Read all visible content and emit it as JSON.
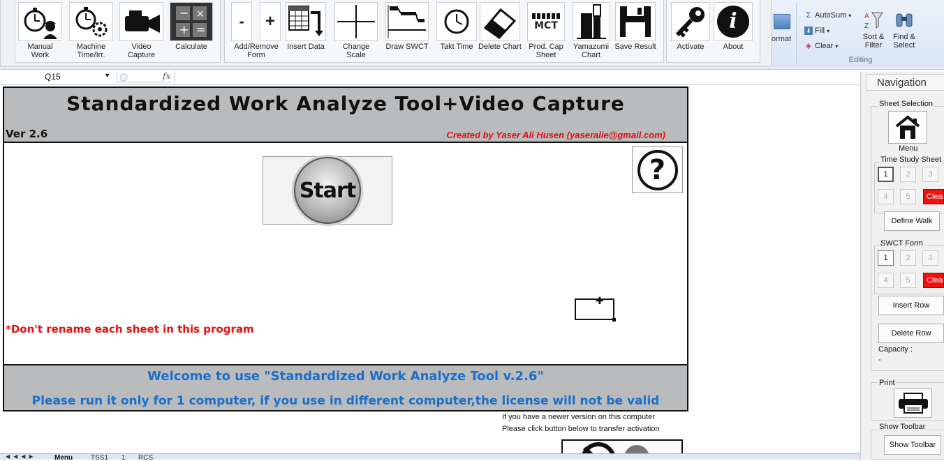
{
  "toolbar": {
    "groups": [
      {
        "buttons": [
          {
            "label": "Manual Work",
            "icon": "stopwatch-worker-icon"
          },
          {
            "label": "Machine Time/Irr.",
            "icon": "stopwatch-gear-icon"
          },
          {
            "label": "Video Capture",
            "icon": "video-camera-icon"
          },
          {
            "label": "Calculate",
            "icon": "calculator-icon"
          }
        ]
      },
      {
        "buttons": [
          {
            "label": "-",
            "icon": "minus-icon"
          },
          {
            "label": "+",
            "icon": "plus-icon"
          },
          {
            "label": "Add/Remove Form",
            "icon": ""
          },
          {
            "label": "Insert Data",
            "icon": "insert-data-icon"
          },
          {
            "label": "Change Scale",
            "icon": "change-scale-icon"
          },
          {
            "label": "Draw SWCT",
            "icon": "draw-swct-icon"
          },
          {
            "label": "Takt Time",
            "icon": "clock-icon"
          },
          {
            "label": "Delete Chart",
            "icon": "eraser-icon"
          },
          {
            "label": "Prod. Cap Sheet",
            "icon": "mct-icon",
            "icon_text": "MCT"
          },
          {
            "label": "Yamazumi Chart",
            "icon": "yamazumi-chart-icon"
          },
          {
            "label": "Save Result",
            "icon": "floppy-disk-icon"
          }
        ]
      },
      {
        "buttons": [
          {
            "label": "Activate",
            "icon": "key-icon"
          },
          {
            "label": "About",
            "icon": "info-icon",
            "icon_text": "i"
          }
        ]
      }
    ]
  },
  "excel_ribbon": {
    "format_label": "ormat",
    "autosum": "AutoSum",
    "fill": "Fill",
    "clear": "Clear",
    "sort_filter": "Sort & Filter",
    "find_select": "Find & Select",
    "group_label": "Editing"
  },
  "formula_bar": {
    "name_box": "Q15",
    "fx": "fx",
    "formula": ""
  },
  "sheet": {
    "title": "Standardized Work Analyze Tool+Video Capture",
    "version": "Ver 2.6",
    "creator": "Created by Yaser Ali Husen (yaseralie@gmail.com)",
    "start_label": "Start",
    "help_symbol": "?",
    "warning": "*Don't rename each sheet in this program",
    "welcome": "Welcome to use \"Standardized Work Analyze Tool v.2.6\"",
    "license_note": "Please run it only for 1 computer, if you use in different computer,the license will not be valid",
    "newer_version_note": "If you have a newer version on this computer",
    "transfer_note": "Please click button below to transfer activation"
  },
  "tabs": {
    "nav_arrows": "◀◀◀▶",
    "items": [
      "Menu",
      "TSS1",
      "1",
      "RCS"
    ]
  },
  "navigation": {
    "title": "Navigation",
    "sheet_selection": "Sheet Selection",
    "menu_label": "Menu",
    "time_study_sheet": "Time Study Sheet",
    "time_study_numbers": [
      "1",
      "2",
      "3",
      "4",
      "5"
    ],
    "clear_label": "Clear",
    "define_walk": "Define Walk",
    "swct_form": "SWCT Form",
    "swct_numbers": [
      "1",
      "2",
      "3",
      "4",
      "5"
    ],
    "insert_row": "Insert Row",
    "delete_row": "Delete Row",
    "capacity_label": "Capacity :",
    "capacity_value": "-",
    "print": "Print",
    "show_toolbar_group": "Show Toolbar",
    "show_toolbar_button": "Show Toolbar"
  },
  "colors": {
    "title_band": "#b9bbbd",
    "creator_red": "#e01010",
    "warning_red": "#e81010",
    "welcome_blue": "#1a6fc9",
    "clear_red": "#ee1111"
  }
}
